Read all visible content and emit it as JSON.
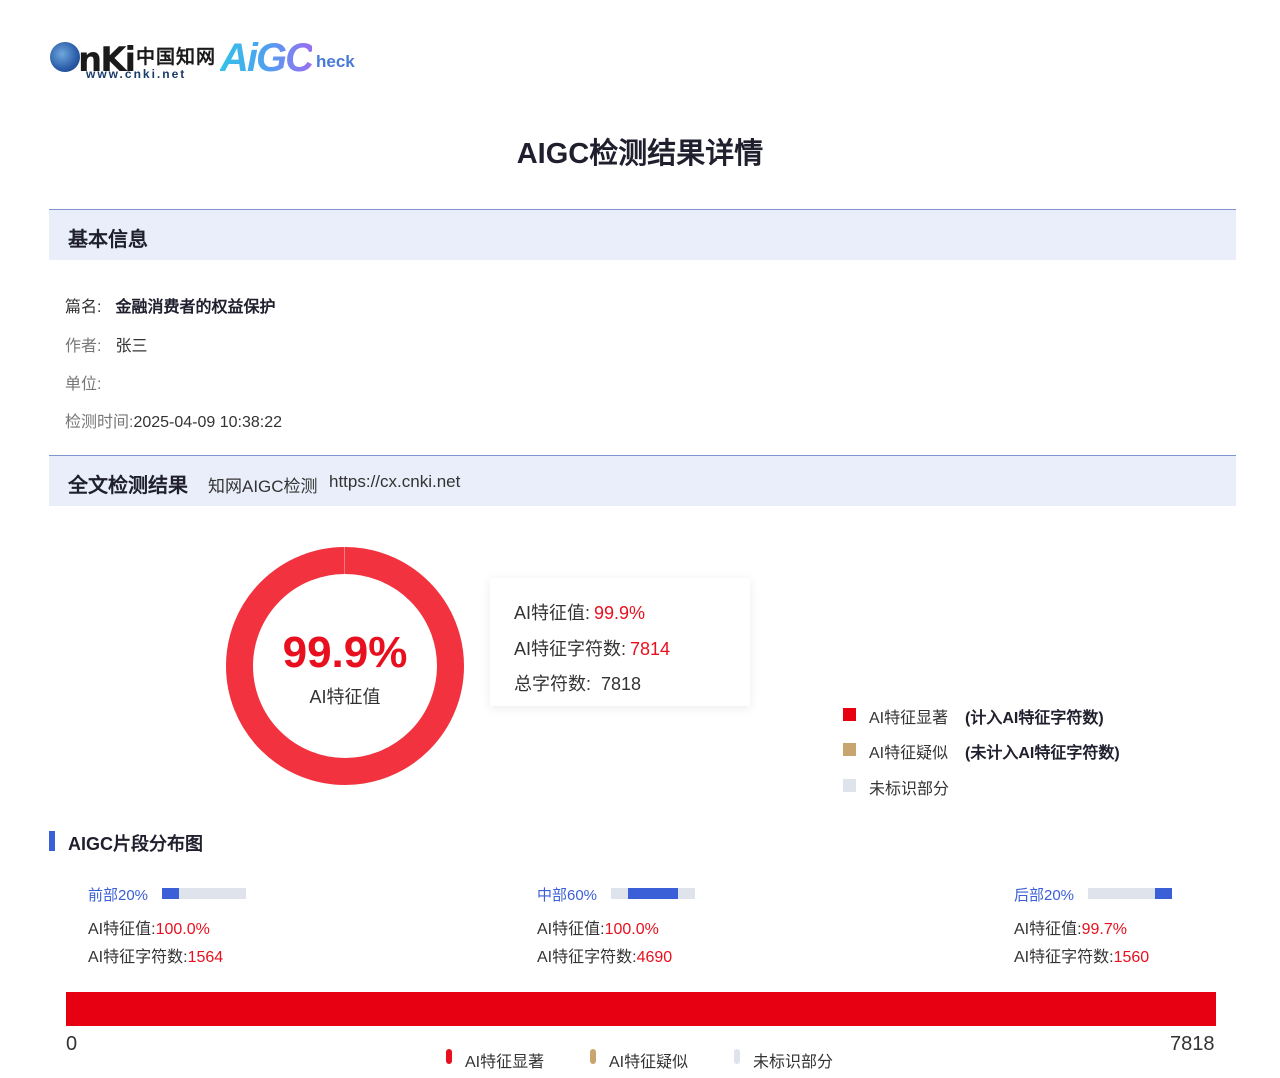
{
  "brand": {
    "cnki_logo": "CNKI",
    "cnki_cn": "中国知网",
    "cnki_url": "www.cnki.net",
    "aigc_logo": "AiGC",
    "aigc_suffix": "heck"
  },
  "page_title": "AIGC检测结果详情",
  "basic_info": {
    "section_title": "基本信息",
    "title_label": "篇名:",
    "title_value": "金融消费者的权益保护",
    "author_label": "作者:",
    "author_value": "张三",
    "unit_label": "单位:",
    "unit_value": "",
    "time_label": "检测时间:",
    "time_value": "2025-04-09 10:38:22"
  },
  "result": {
    "section_title": "全文检测结果",
    "source_label": "知网AIGC检测",
    "source_url": "https://cx.cnki.net",
    "donut_value": "99.9%",
    "donut_label": "AI特征值",
    "donut_fraction": 0.999,
    "stats": {
      "ai_value_label": "AI特征值:",
      "ai_value": "99.9%",
      "ai_chars_label": "AI特征字符数:",
      "ai_chars": "7814",
      "total_chars_label": "总字符数:",
      "total_chars": "7818"
    },
    "legend": [
      {
        "label": "AI特征显著",
        "note": "(计入AI特征字符数)",
        "color": "#e60012"
      },
      {
        "label": "AI特征疑似",
        "note": "(未计入AI特征字符数)",
        "color": "#c8a46e"
      },
      {
        "label": "未标识部分",
        "note": "",
        "color": "#dfe3ec"
      }
    ]
  },
  "distribution": {
    "title": "AIGC片段分布图",
    "segments": [
      {
        "name": "前部20%",
        "ai_value_label": "AI特征值:",
        "ai_value": "100.0%",
        "ai_chars_label": "AI特征字符数:",
        "ai_chars": "1564",
        "range": [
          0,
          0.2
        ]
      },
      {
        "name": "中部60%",
        "ai_value_label": "AI特征值:",
        "ai_value": "100.0%",
        "ai_chars_label": "AI特征字符数:",
        "ai_chars": "4690",
        "range": [
          0.2,
          0.8
        ]
      },
      {
        "name": "后部20%",
        "ai_value_label": "AI特征值:",
        "ai_value": "99.7%",
        "ai_chars_label": "AI特征字符数:",
        "ai_chars": "1560",
        "range": [
          0.8,
          1.0
        ]
      }
    ],
    "axis_min": "0",
    "axis_max": "7818",
    "bar_color": "#e60012",
    "legend": [
      {
        "label": "AI特征显著",
        "color": "#e8101e"
      },
      {
        "label": "AI特征疑似",
        "color": "#c8a46e"
      },
      {
        "label": "未标识部分",
        "color": "#dfe3ec"
      }
    ]
  }
}
